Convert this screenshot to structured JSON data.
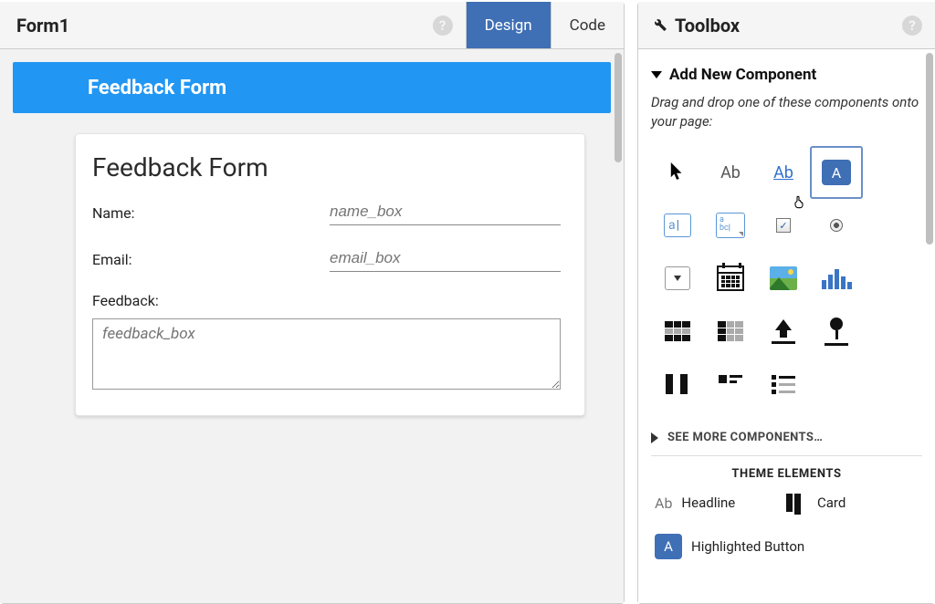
{
  "header": {
    "form_title": "Form1",
    "tab_design": "Design",
    "tab_code": "Code"
  },
  "canvas": {
    "bar_title": "Feedback Form",
    "card_title": "Feedback Form",
    "name_label": "Name:",
    "name_placeholder": "name_box",
    "email_label": "Email:",
    "email_placeholder": "email_box",
    "feedback_label": "Feedback:",
    "feedback_placeholder": "feedback_box"
  },
  "toolbox": {
    "title": "Toolbox",
    "section_title": "Add New Component",
    "hint": "Drag and drop one of these components onto your page:",
    "more": "SEE MORE COMPONENTS…",
    "theme_title": "THEME ELEMENTS",
    "theme_headline": "Headline",
    "theme_card": "Card",
    "theme_hbutton": "Highlighted Button",
    "components": {
      "label_glyph": "Ab",
      "link_glyph": "Ab",
      "button_glyph": "A",
      "textbox_glyph": "a|",
      "textarea_glyph": "a\nbc|"
    }
  }
}
